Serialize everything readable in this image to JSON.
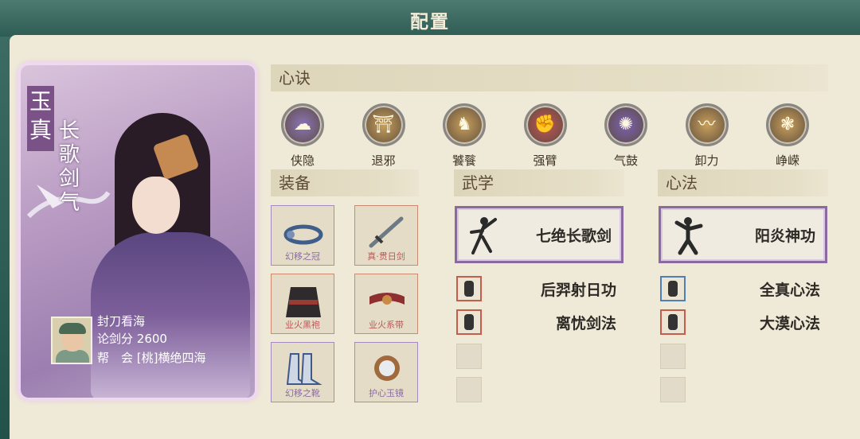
{
  "header": {
    "title": "配置"
  },
  "character": {
    "name": "玉真",
    "skill_title": "长歌剑气",
    "player": {
      "name": "封刀看海",
      "rank_label": "论剑分",
      "rank_value": "2600",
      "guild_label": "帮　会",
      "guild_value": "[桃]横绝四海"
    }
  },
  "sections": {
    "xinjue": "心诀",
    "zhuangbei": "装备",
    "wuxue": "武学",
    "xinfa": "心法"
  },
  "xinjue_items": [
    {
      "label": "侠隐",
      "icon": "swirl-cloud-icon",
      "color": "#8c74b8"
    },
    {
      "label": "退邪",
      "icon": "pillar-glow-icon",
      "color": "#c9a05a"
    },
    {
      "label": "饕餮",
      "icon": "beast-icon",
      "color": "#c9a05a"
    },
    {
      "label": "强臂",
      "icon": "fist-icon",
      "color": "#c05656"
    },
    {
      "label": "气鼓",
      "icon": "vortex-icon",
      "color": "#7c62b0"
    },
    {
      "label": "卸力",
      "icon": "wind-swirl-icon",
      "color": "#c9a05a"
    },
    {
      "label": "峥嵘",
      "icon": "cloud-beast-icon",
      "color": "#c9a05a"
    }
  ],
  "equipment": [
    {
      "label": "幻移之冠",
      "icon": "headband-icon",
      "tone": "purple"
    },
    {
      "label": "真·贯日剑",
      "icon": "sword-icon",
      "tone": "red"
    },
    {
      "label": "业火黑袍",
      "icon": "robe-icon",
      "tone": "red"
    },
    {
      "label": "业火系带",
      "icon": "belt-icon",
      "tone": "red"
    },
    {
      "label": "幻移之靴",
      "icon": "boots-icon",
      "tone": "purple"
    },
    {
      "label": "护心玉镜",
      "icon": "mirror-icon",
      "tone": "purple"
    }
  ],
  "wuxue": {
    "main": {
      "label": "七绝长歌剑",
      "icon": "sword-dancer-icon"
    },
    "subs": [
      {
        "label": "后羿射日功",
        "icon": "archer-icon"
      },
      {
        "label": "离忧剑法",
        "icon": "swordsman-icon"
      }
    ]
  },
  "xinfa": {
    "main": {
      "label": "阳炎神功",
      "icon": "martial-artist-icon"
    },
    "subs": [
      {
        "label": "全真心法",
        "icon": "meditating-icon"
      },
      {
        "label": "大漠心法",
        "icon": "warrior-icon"
      }
    ]
  }
}
